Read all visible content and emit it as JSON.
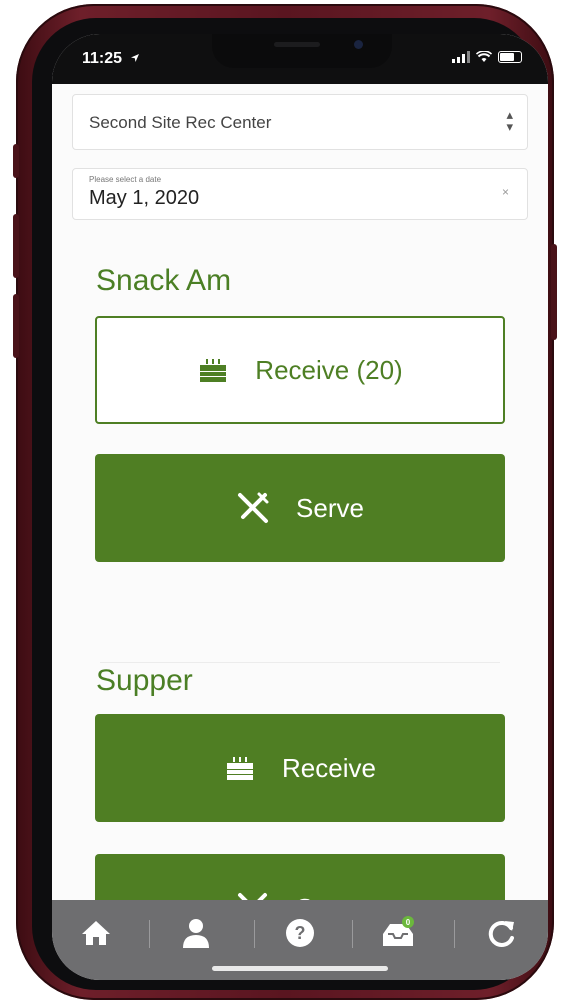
{
  "status_bar": {
    "time": "11:25",
    "location_icon": "location-arrow-icon",
    "signal_icon": "signal-icon",
    "wifi_icon": "wifi-icon",
    "battery_icon": "battery-icon"
  },
  "site_select": {
    "value": "Second Site Rec Center",
    "icon": "select-arrows-icon"
  },
  "date_select": {
    "placeholder": "Please select a date",
    "value": "May 1, 2020",
    "clear_icon": "clear-icon"
  },
  "meals": [
    {
      "title": "Snack Am",
      "receive_label": "Receive (20)",
      "serve_label": "Serve"
    },
    {
      "title": "Supper",
      "receive_label": "Receive",
      "serve_label": "Serve"
    }
  ],
  "tabbar": {
    "items": [
      "home-icon",
      "user-icon",
      "help-icon",
      "inbox-icon",
      "refresh-icon"
    ],
    "inbox_badge": "0"
  },
  "colors": {
    "accent": "#4f7e23",
    "tabbar": "#6e6e70",
    "frame": "#5a1520"
  }
}
